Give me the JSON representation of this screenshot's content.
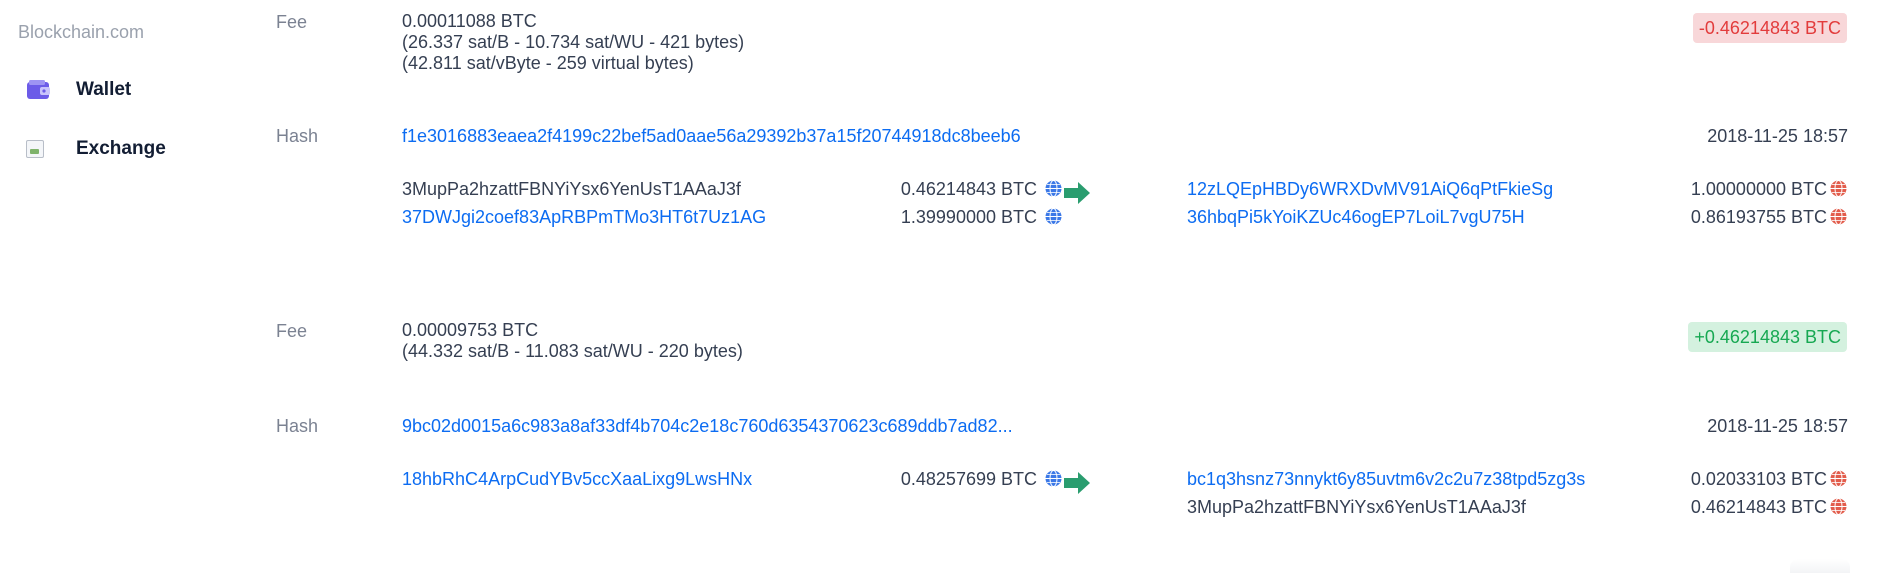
{
  "sidebar": {
    "brand": "Blockchain.com",
    "items": [
      {
        "label": "Wallet",
        "icon": "wallet-icon"
      },
      {
        "label": "Exchange",
        "icon": "broken-image-icon"
      }
    ]
  },
  "colors": {
    "link": "#0c6cf2",
    "negative_text": "#e23c3c",
    "negative_bg": "#f8d7d9",
    "positive_text": "#17a852",
    "positive_bg": "#d4f1df",
    "arrow": "#2a9d6f",
    "globe_spent": "#3b78e7",
    "globe_unspent": "#e25c4b"
  },
  "transactions": [
    {
      "fee_label": "Fee",
      "fee": "0.00011088 BTC",
      "fee_detail_1": "(26.337 sat/B - 10.734 sat/WU - 421 bytes)",
      "fee_detail_2": "(42.811 sat/vByte - 259 virtual bytes)",
      "amount_badge": "-0.46214843 BTC",
      "hash_label": "Hash",
      "hash": "f1e3016883eaea2f4199c22bef5ad0aae56a29392b37a15f20744918dc8beeb6",
      "timestamp": "2018-11-25 18:57",
      "inputs": [
        {
          "address": "3MupPa2hzattFBNYiYsx6YenUsT1AAaJ3f",
          "amount": "0.46214843 BTC"
        },
        {
          "address": "37DWJgi2coef83ApRBPmTMo3HT6t7Uz1AG",
          "amount": "1.39990000 BTC"
        }
      ],
      "outputs": [
        {
          "address": "12zLQEpHBDy6WRXDvMV91AiQ6qPtFkieSg",
          "amount": "1.00000000 BTC"
        },
        {
          "address": "36hbqPi5kYoiKZUc46ogEP7LoiL7vgU75H",
          "amount": "0.86193755 BTC"
        }
      ]
    },
    {
      "fee_label": "Fee",
      "fee": "0.00009753 BTC",
      "fee_detail_1": "(44.332 sat/B - 11.083 sat/WU - 220 bytes)",
      "amount_badge": "+0.46214843 BTC",
      "hash_label": "Hash",
      "hash": "9bc02d0015a6c983a8af33df4b704c2e18c760d6354370623c689ddb7ad82...",
      "timestamp": "2018-11-25 18:57",
      "inputs": [
        {
          "address": "18hbRhC4ArpCudYBv5ccXaaLixg9LwsHNx",
          "amount": "0.48257699 BTC"
        }
      ],
      "outputs": [
        {
          "address": "bc1q3hsnz73nnykt6y85uvtm6v2c2u7z38tpd5zg3s",
          "amount": "0.02033103 BTC"
        },
        {
          "address": "3MupPa2hzattFBNYiYsx6YenUsT1AAaJ3f",
          "amount": "0.46214843 BTC"
        }
      ]
    }
  ]
}
